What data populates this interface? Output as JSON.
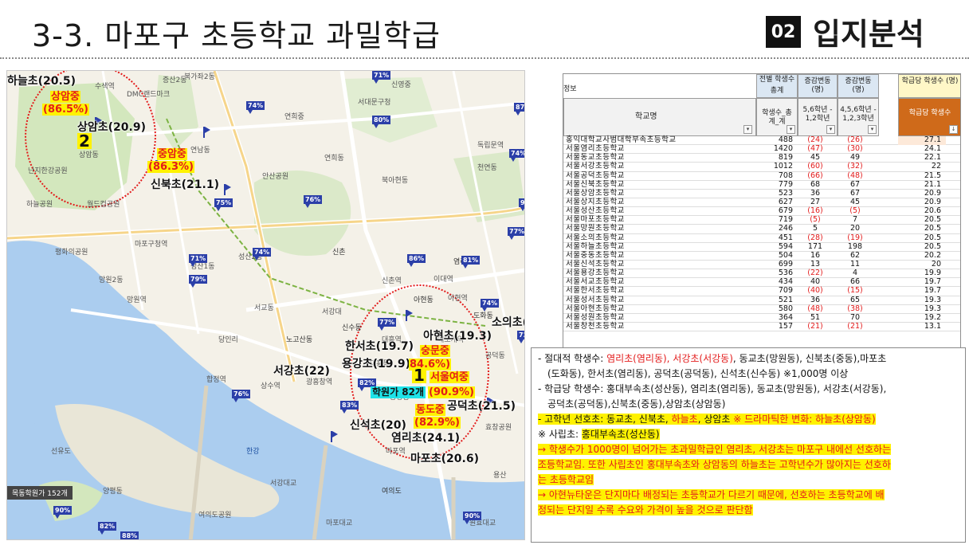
{
  "header": {
    "title": "3-3. 마포구 초등학교 과밀학급",
    "section_no": "02",
    "section_name": "입지분석"
  },
  "map": {
    "schools": [
      {
        "key": "haneul",
        "label": "하늘초(20.5)"
      },
      {
        "key": "sangam",
        "label": "상암초(20.9)"
      },
      {
        "key": "sinbuk",
        "label": "신북초(21.1)"
      },
      {
        "key": "sosui",
        "label": "소의초(20.5)"
      },
      {
        "key": "ahyeon",
        "label": "아현초(19.3)"
      },
      {
        "key": "hanseo",
        "label": "한서초(19.7)"
      },
      {
        "key": "yonggang",
        "label": "용강초(19.9)"
      },
      {
        "key": "seogang",
        "label": "서강초(22)"
      },
      {
        "key": "gongdeok",
        "label": "공덕초(21.5)"
      },
      {
        "key": "sinseok",
        "label": "신석초(20)"
      },
      {
        "key": "yeomni",
        "label": "염리초(24.1)"
      },
      {
        "key": "mapo",
        "label": "마포초(20.6)"
      }
    ],
    "middle_schools": [
      {
        "key": "sangam_mid",
        "name": "상암중",
        "pct": "(86.5%)"
      },
      {
        "key": "jungam_mid",
        "name": "중암중",
        "pct": "(86.3%)"
      },
      {
        "key": "sungmun_mid",
        "name": "숭문중",
        "pct": "84.6%)"
      },
      {
        "key": "seoulyeo_mid",
        "name": "서울여중",
        "pct": "(90.9%)"
      },
      {
        "key": "dongdo_mid",
        "name": "동도중",
        "pct": "(82.9%)"
      }
    ],
    "cluster_numbers": [
      "2",
      "1"
    ],
    "class_note": "학원가 82개",
    "caption": "목동학원가 152개",
    "pct_markers": [
      "71%",
      "87%",
      "74%",
      "80%",
      "74%",
      "75%",
      "76%",
      "90%",
      "77%",
      "71%",
      "79%",
      "74%",
      "86%",
      "81%",
      "74%",
      "77%",
      "82%",
      "76%",
      "83%",
      "90%",
      "82%",
      "88%",
      "90%",
      "72%"
    ],
    "place_labels": [
      "수색역",
      "DMC랜드마크",
      "증산2동",
      "북가좌2동",
      "신영중",
      "서대문구청",
      "연희중",
      "연희동",
      "독립문역",
      "천연동",
      "상암동",
      "연남동",
      "서교동",
      "합정역",
      "망원2동",
      "망원역",
      "마포구청역",
      "성산1동",
      "성산2동",
      "신촌역",
      "이대역",
      "아현역",
      "공덕역",
      "애오개역",
      "대흥역",
      "서강대",
      "광흥창역",
      "상수역",
      "당인리",
      "용강동",
      "마포역",
      "여의도",
      "한강",
      "여의도공원",
      "서강대교",
      "마포대교",
      "원효대교",
      "선유도",
      "양평동",
      "신촌",
      "아현동",
      "도화동",
      "염리동",
      "대흥동",
      "신수동",
      "노고산동",
      "난지한강공원",
      "하늘공원",
      "월드컵공원",
      "평화의공원",
      "안산공원",
      "북아현동",
      "공덕동",
      "효창공원",
      "용산"
    ]
  },
  "table": {
    "headers": {
      "left_label": "정보",
      "name_col": "학교명",
      "total_top": "전별 학생수",
      "total_sub": "총계",
      "total_f": "학생수_총계_계",
      "d1_top": "증감변동 (명)",
      "d1_f": "5,6학년 - 1,2학년",
      "d2_top": "증감변동 (명)",
      "d2_f": "4,5,6학년 - 1,2,3학년",
      "per_top": "학급당 학생수 (명)",
      "per_f": "학급당 학생수"
    },
    "rows": [
      {
        "name": "홍익대학교사범대학부속초등학교",
        "total": "488",
        "d1": "(24)",
        "d2": "(26)",
        "per": "27.1"
      },
      {
        "name": "서울염리초등학교",
        "total": "1420",
        "d1": "(47)",
        "d2": "(30)",
        "per": "24.1"
      },
      {
        "name": "서울동교초등학교",
        "total": "819",
        "d1": "45",
        "d2": "49",
        "per": "22.1"
      },
      {
        "name": "서울서강초등학교",
        "total": "1012",
        "d1": "(60)",
        "d2": "(32)",
        "per": "22"
      },
      {
        "name": "서울공덕초등학교",
        "total": "708",
        "d1": "(66)",
        "d2": "(48)",
        "per": "21.5"
      },
      {
        "name": "서울신북초등학교",
        "total": "779",
        "d1": "68",
        "d2": "67",
        "per": "21.1"
      },
      {
        "name": "서울상암초등학교",
        "total": "523",
        "d1": "36",
        "d2": "67",
        "per": "20.9"
      },
      {
        "name": "서울상지초등학교",
        "total": "627",
        "d1": "27",
        "d2": "45",
        "per": "20.9"
      },
      {
        "name": "서울성산초등학교",
        "total": "679",
        "d1": "(16)",
        "d2": "(5)",
        "per": "20.6"
      },
      {
        "name": "서울마포초등학교",
        "total": "719",
        "d1": "(5)",
        "d2": "7",
        "per": "20.5"
      },
      {
        "name": "서울망원초등학교",
        "total": "246",
        "d1": "5",
        "d2": "20",
        "per": "20.5"
      },
      {
        "name": "서울소의초등학교",
        "total": "451",
        "d1": "(28)",
        "d2": "(19)",
        "per": "20.5"
      },
      {
        "name": "서울하늘초등학교",
        "total": "594",
        "d1": "171",
        "d2": "198",
        "per": "20.5"
      },
      {
        "name": "서울중동초등학교",
        "total": "504",
        "d1": "16",
        "d2": "62",
        "per": "20.2"
      },
      {
        "name": "서울신석초등학교",
        "total": "699",
        "d1": "13",
        "d2": "11",
        "per": "20"
      },
      {
        "name": "서울용강초등학교",
        "total": "536",
        "d1": "(22)",
        "d2": "4",
        "per": "19.9"
      },
      {
        "name": "서울서교초등학교",
        "total": "434",
        "d1": "40",
        "d2": "66",
        "per": "19.7"
      },
      {
        "name": "서울한서초등학교",
        "total": "709",
        "d1": "(40)",
        "d2": "(15)",
        "per": "19.7"
      },
      {
        "name": "서울성서초등학교",
        "total": "521",
        "d1": "36",
        "d2": "65",
        "per": "19.3"
      },
      {
        "name": "서울아현초등학교",
        "total": "580",
        "d1": "(48)",
        "d2": "(38)",
        "per": "19.3"
      },
      {
        "name": "서울성원초등학교",
        "total": "364",
        "d1": "51",
        "d2": "70",
        "per": "19.2"
      },
      {
        "name": "서울창천초등학교",
        "total": "157",
        "d1": "(21)",
        "d2": "(21)",
        "per": "13.1"
      }
    ]
  },
  "notes": {
    "l1a": "- 절대적 학생수: ",
    "l1b": "염리초(염리동), 서강초(서강동)",
    "l1c": ", 동교초(망원동), 신북초(중동),마포초",
    "l2a": "(도화동), 한서초(염리동), 공덕초(공덕동), 신석초(신수동)  ",
    "l2b": "※1,000명 이상",
    "l3": "- 학급당 학생수: 홍대부속초(성산동), 염리초(염리동), 동교초(망원동), 서강초(서강동),",
    "l4": "공덕초(공덕동),신북초(중동),상암초(상암동)",
    "l5a": "- 고학년 선호초: 동교초, 신북초, ",
    "l5b": "하늘초",
    "l5c": ", 상암초  ",
    "l5d": "※ 드라마틱한 변화: 하늘초(상암동)",
    "l6a": "※ 사립초: ",
    "l6b": "홍대부속초(성산동)",
    "l7a": "→ 학생수가 1000명이 넘어가는 초과밀학급인 ",
    "l7b": "염리초, 서강초",
    "l7c": "는 마포구 내에선 선호하는",
    "l8a": "조등학교임. 또한 사립초인 ",
    "l8b": "홍대부속초",
    "l8c": "와 상암동의 ",
    "l8d": "하늘초",
    "l8e": "는 고학년수가 많아지는 선호하",
    "l9": "는 초등학교임",
    "l10": "→ 아현뉴타운은 단지마다 배정되는 초등학교가 다르기 때문에, 선호하는 초등학교에 배",
    "l11": "정되는 단지일 수록 수요와 가격이 높을 것으로 판단함"
  },
  "colors": {
    "highlight_yellow": "#fff200",
    "accent_red": "#e31b1b",
    "marker_blue": "#2b3fa8",
    "river_blue": "#a9cbee",
    "park_green": "#cfe6b5"
  }
}
